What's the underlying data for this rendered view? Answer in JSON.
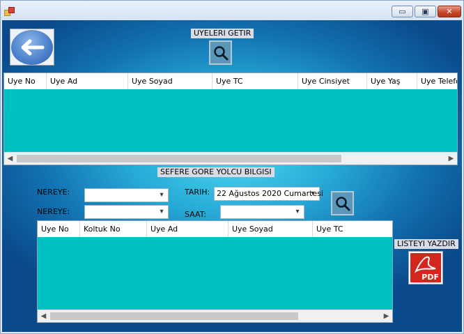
{
  "window": {
    "minimize_glyph": "▭",
    "maximize_glyph": "▣",
    "close_glyph": "✕"
  },
  "members": {
    "get_label": "UYELERI GETIR",
    "columns": [
      "Uye No",
      "Uye Ad",
      "Uye Soyad",
      "Uye TC",
      "Uye Cinsiyet",
      "Uye Yaş",
      "Uye Telefo"
    ]
  },
  "passenger_info": {
    "section_label": "SEFERE GORE YOLCU BILGISI",
    "from_label": "NEREYE:",
    "to_label": "NEREYE:",
    "date_label": "TARIH:",
    "date_value": "22 Ağustos 2020 Cumartesi",
    "time_label": "SAAT:",
    "from_value": "",
    "to_value": "",
    "time_value": "",
    "columns": [
      "Uye No",
      "Koltuk No",
      "Uye Ad",
      "Uye Soyad",
      "Uye TC"
    ]
  },
  "print": {
    "label": "LISTEYI YAZDIR",
    "pdf_text": "PDF"
  },
  "icons": {
    "back": "arrow-left-icon",
    "search": "magnifier-icon",
    "pdf": "pdf-icon"
  },
  "colors": {
    "grid_background": "#00c1c1",
    "pdf_red": "#d4261c"
  }
}
